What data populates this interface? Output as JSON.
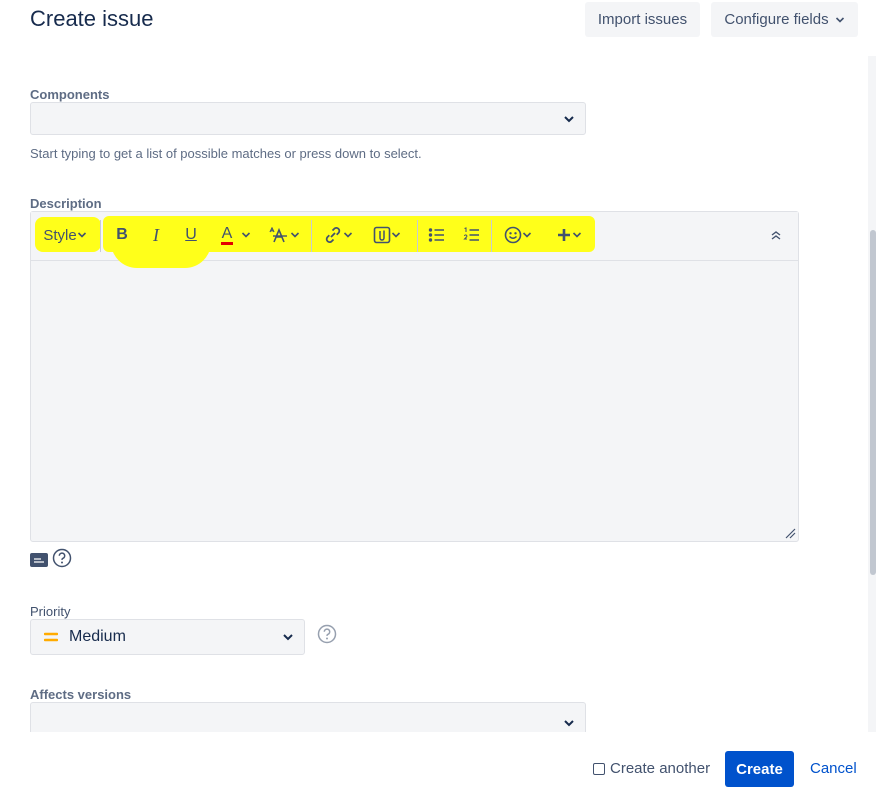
{
  "header": {
    "title": "Create issue",
    "import_label": "Import issues",
    "configure_label": "Configure fields"
  },
  "components": {
    "label": "Components",
    "value": "",
    "help": "Start typing to get a list of possible matches or press down to select."
  },
  "description": {
    "label": "Description",
    "toolbar": {
      "style_label": "Style",
      "bold": "B",
      "italic": "I",
      "underline": "U",
      "text_color": "A",
      "text_color_underline": "#e30000"
    }
  },
  "priority": {
    "label": "Priority",
    "value": "Medium",
    "icon_color": "#ffab00"
  },
  "affects_versions": {
    "label": "Affects versions",
    "value": ""
  },
  "footer": {
    "create_another_label": "Create another",
    "create_label": "Create",
    "cancel_label": "Cancel"
  },
  "colors": {
    "highlight": "#ffff1a",
    "primary": "#0052cc"
  }
}
